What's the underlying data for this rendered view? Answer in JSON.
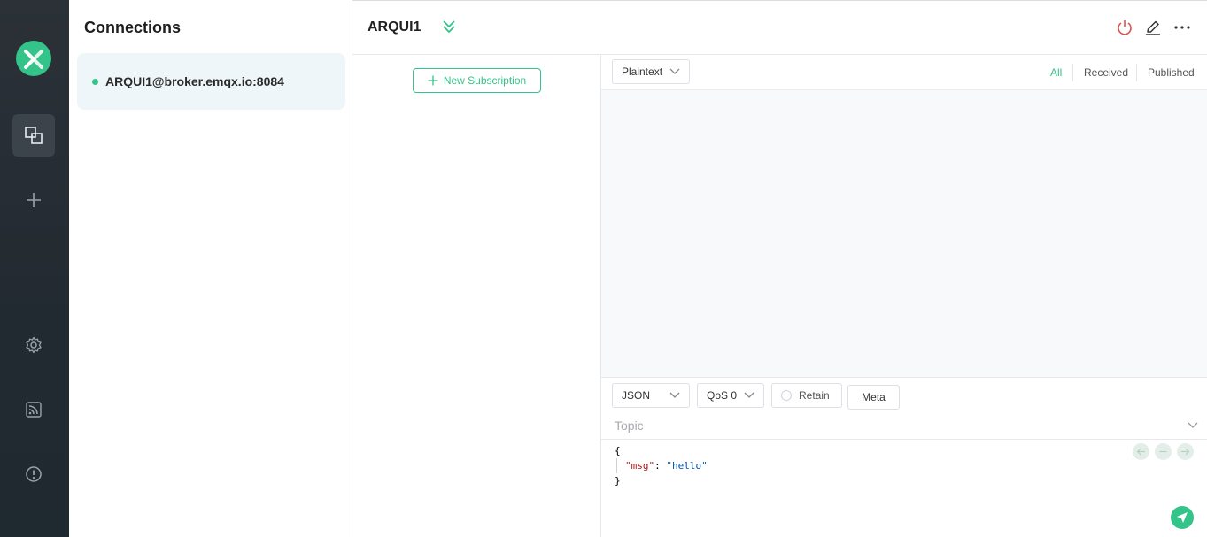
{
  "sidebar": {
    "icons": [
      "logo-icon",
      "connections-icon",
      "plus-icon",
      "gear-icon",
      "rss-icon",
      "info-icon"
    ]
  },
  "connections": {
    "title": "Connections",
    "items": [
      {
        "label": "ARQUI1@broker.emqx.io:8084",
        "status": "connected"
      }
    ]
  },
  "header": {
    "connection_name": "ARQUI1"
  },
  "subscriptions": {
    "new_button": "New Subscription"
  },
  "messages": {
    "format": "Plaintext",
    "filters": {
      "all": "All",
      "received": "Received",
      "published": "Published"
    },
    "active_filter": "All"
  },
  "publish": {
    "payload_format": "JSON",
    "qos": "QoS 0",
    "retain_label": "Retain",
    "retain_checked": false,
    "meta_label": "Meta",
    "topic_placeholder": "Topic",
    "payload_lines": [
      "{",
      "\"msg\"",
      ": ",
      "\"hello\"",
      "}"
    ]
  },
  "colors": {
    "accent": "#34c388",
    "sidebar_bg": "#252d34",
    "disconnect": "#e0524f"
  }
}
